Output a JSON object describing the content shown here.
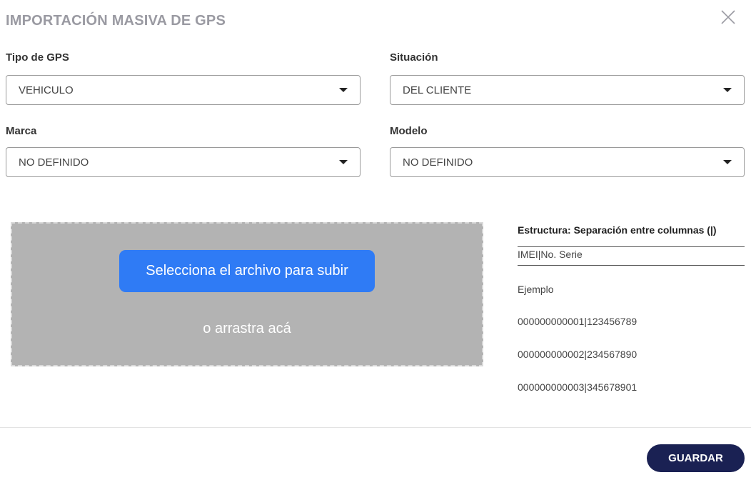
{
  "dialog": {
    "title": "IMPORTACIÓN MASIVA DE GPS",
    "close_icon": "close-icon"
  },
  "fields": {
    "tipo_gps": {
      "label": "Tipo de GPS",
      "value": "VEHICULO"
    },
    "situacion": {
      "label": "Situación",
      "value": "DEL CLIENTE"
    },
    "marca": {
      "label": "Marca",
      "value": "NO DEFINIDO"
    },
    "modelo": {
      "label": "Modelo",
      "value": "NO DEFINIDO"
    }
  },
  "upload": {
    "button_label": "Selecciona el archivo para subir",
    "drag_text": "o arrastra acá"
  },
  "structure": {
    "title": "Estructura: Separación entre columnas (|)",
    "header": "IMEI|No. Serie",
    "example_label": "Ejemplo",
    "examples": [
      "000000000001|123456789",
      "000000000002|234567890",
      "000000000003|345678901"
    ]
  },
  "footer": {
    "save_label": "GUARDAR"
  },
  "colors": {
    "primary_blue": "#2f7bf5",
    "save_navy": "#1a2153",
    "dropzone_gray": "#b3b3b3",
    "title_gray": "#9a9aa2"
  }
}
